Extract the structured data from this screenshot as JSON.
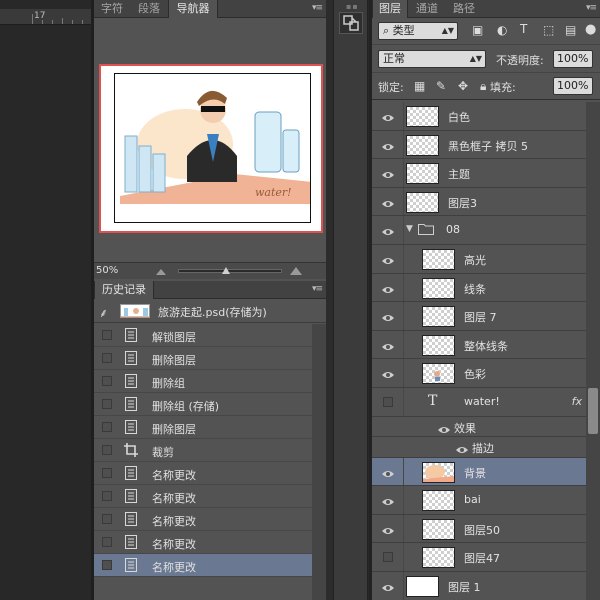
{
  "ruler": {
    "number": "17"
  },
  "mid_tabs": [
    {
      "label": "字符",
      "active": false
    },
    {
      "label": "段落",
      "active": false
    },
    {
      "label": "导航器",
      "active": true
    }
  ],
  "navigator": {
    "zoom": "50%",
    "thumb_caption": "water!"
  },
  "history": {
    "tab": "历史记录",
    "snapshot_label": "旅游走起.psd(存储为)",
    "items": [
      {
        "label": "解锁图层",
        "icon": "document-icon",
        "selected": false
      },
      {
        "label": "删除图层",
        "icon": "document-icon",
        "selected": false
      },
      {
        "label": "删除组",
        "icon": "document-icon",
        "selected": false
      },
      {
        "label": "删除组 (存储)",
        "icon": "document-icon",
        "selected": false
      },
      {
        "label": "删除图层",
        "icon": "document-icon",
        "selected": false
      },
      {
        "label": "裁剪",
        "icon": "crop-icon",
        "selected": false
      },
      {
        "label": "名称更改",
        "icon": "document-icon",
        "selected": false
      },
      {
        "label": "名称更改",
        "icon": "document-icon",
        "selected": false
      },
      {
        "label": "名称更改",
        "icon": "document-icon",
        "selected": false
      },
      {
        "label": "名称更改",
        "icon": "document-icon",
        "selected": false
      },
      {
        "label": "名称更改",
        "icon": "document-icon",
        "selected": true
      }
    ]
  },
  "layers_panel": {
    "tabs": [
      {
        "label": "图层",
        "active": true
      },
      {
        "label": "通道",
        "active": false
      },
      {
        "label": "路径",
        "active": false
      }
    ],
    "filter_kind": "类型",
    "blend_mode": "正常",
    "opacity_label": "不透明度:",
    "opacity": "100%",
    "lock_label": "锁定:",
    "fill_label": "填充:",
    "fill": "100%",
    "layers": [
      {
        "name": "白色",
        "visible": true,
        "indent": 0,
        "thumb": "checker"
      },
      {
        "name": "黑色框子 拷贝 5",
        "visible": true,
        "indent": 0,
        "thumb": "checker"
      },
      {
        "name": "主题",
        "visible": true,
        "indent": 0,
        "thumb": "checker"
      },
      {
        "name": "图层3",
        "visible": true,
        "indent": 0,
        "thumb": "checker"
      },
      {
        "name": "08",
        "visible": true,
        "indent": 0,
        "type": "group"
      },
      {
        "name": "高光",
        "visible": true,
        "indent": 1,
        "thumb": "checker"
      },
      {
        "name": "线条",
        "visible": true,
        "indent": 1,
        "thumb": "checker"
      },
      {
        "name": "图层 7",
        "visible": true,
        "indent": 1,
        "thumb": "checker"
      },
      {
        "name": "整体线条",
        "visible": true,
        "indent": 1,
        "thumb": "checker"
      },
      {
        "name": "色彩",
        "visible": true,
        "indent": 1,
        "thumb": "art"
      },
      {
        "name": "water!",
        "visible": false,
        "indent": 1,
        "type": "text",
        "fx": "fx"
      },
      {
        "name": "效果",
        "visible": true,
        "indent": 2,
        "type": "effect"
      },
      {
        "name": "描边",
        "visible": true,
        "indent": 3,
        "type": "effect"
      },
      {
        "name": "背景",
        "visible": true,
        "indent": 1,
        "thumb": "art-bg",
        "selected": true
      },
      {
        "name": "bai",
        "visible": true,
        "indent": 1,
        "thumb": "checker"
      },
      {
        "name": "图层50",
        "visible": true,
        "indent": 1,
        "thumb": "checker"
      },
      {
        "name": "图层47",
        "visible": false,
        "indent": 1,
        "thumb": "checker"
      },
      {
        "name": "图层 1",
        "visible": true,
        "indent": 0,
        "thumb": "white"
      }
    ]
  },
  "colors": {
    "accent_selected": "#6a7891",
    "nav_frame": "#e05252",
    "panel_bg": "#535353"
  }
}
